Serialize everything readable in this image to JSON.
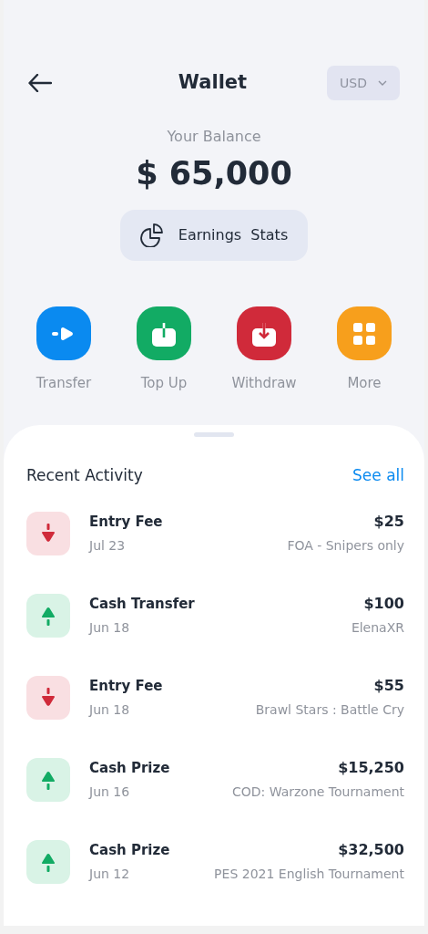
{
  "header": {
    "title": "Wallet",
    "currency": "USD"
  },
  "balance": {
    "label": "Your Balance",
    "amount": "$ 65,000",
    "stats_button": "Earnings  Stats"
  },
  "actions": [
    {
      "kind": "transfer",
      "label": "Transfer",
      "color": "#0a8af0"
    },
    {
      "kind": "top_up",
      "label": "Top Up",
      "color": "#12ab64"
    },
    {
      "kind": "withdraw",
      "label": "Withdraw",
      "color": "#d02a3a"
    },
    {
      "kind": "more",
      "label": "More",
      "color": "#f79f1c"
    }
  ],
  "activity": {
    "title": "Recent Activity",
    "see_all": "See all",
    "items": [
      {
        "kind": "debit",
        "title": "Entry Fee",
        "date": "Jul 23",
        "amount": "$25",
        "detail": "FOA - Snipers only"
      },
      {
        "kind": "credit",
        "title": "Cash Transfer",
        "date": "Jun 18",
        "amount": "$100",
        "detail": "ElenaXR"
      },
      {
        "kind": "debit",
        "title": "Entry Fee",
        "date": "Jun 18",
        "amount": "$55",
        "detail": "Brawl Stars : Battle Cry"
      },
      {
        "kind": "credit",
        "title": "Cash Prize",
        "date": "Jun 16",
        "amount": "$15,250",
        "detail": "COD: Warzone Tournament"
      },
      {
        "kind": "credit",
        "title": "Cash Prize",
        "date": "Jun 12",
        "amount": "$32,500",
        "detail": "PES 2021 English Tournament"
      }
    ]
  }
}
